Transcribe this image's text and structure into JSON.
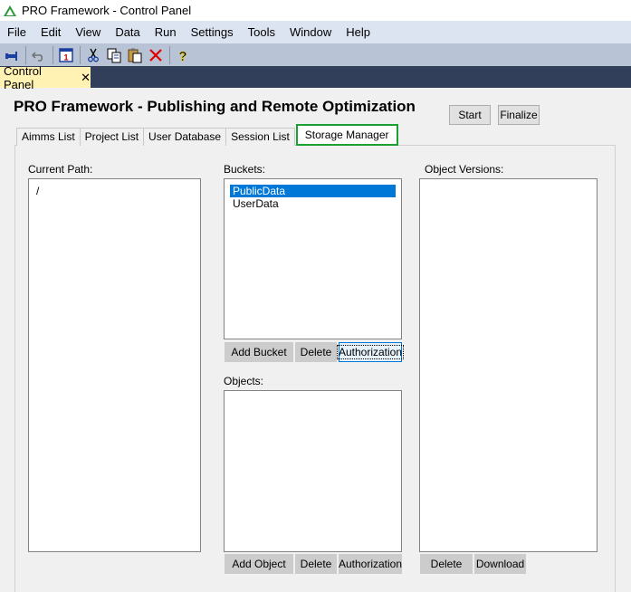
{
  "window": {
    "title": "PRO Framework - Control Panel",
    "icon": "aimms-logo-icon"
  },
  "menu": [
    "File",
    "Edit",
    "View",
    "Data",
    "Run",
    "Settings",
    "Tools",
    "Window",
    "Help"
  ],
  "toolbar": {
    "icons": [
      "pin-icon",
      "undo-icon",
      "calendar-icon",
      "cut-icon",
      "copy-icon",
      "paste-icon",
      "delete-icon",
      "help-icon"
    ]
  },
  "doc_tab": {
    "label": "Control Panel",
    "close": "✕"
  },
  "panel": {
    "title": "PRO Framework - Publishing and Remote Optimization",
    "start_label": "Start",
    "finalize_label": "Finalize"
  },
  "tabs": [
    "Aimms List",
    "Project List",
    "User Database",
    "Session List",
    "Storage Manager"
  ],
  "storage": {
    "current_path_label": "Current Path:",
    "current_path_items": [
      "/"
    ],
    "buckets_label": "Buckets:",
    "buckets": [
      "PublicData",
      "UserData"
    ],
    "add_bucket_label": "Add Bucket",
    "delete_bucket_label": "Delete",
    "bucket_authorization_label": "Authorization",
    "objects_label": "Objects:",
    "add_object_label": "Add Object",
    "delete_object_label": "Delete",
    "object_authorization_label": "Authorization",
    "object_versions_label": "Object Versions:",
    "delete_version_label": "Delete",
    "download_label": "Download"
  },
  "colors": {
    "selection": "#0078d7",
    "active_tab_border": "#1aa033",
    "doc_tab": "#fff2b3"
  }
}
